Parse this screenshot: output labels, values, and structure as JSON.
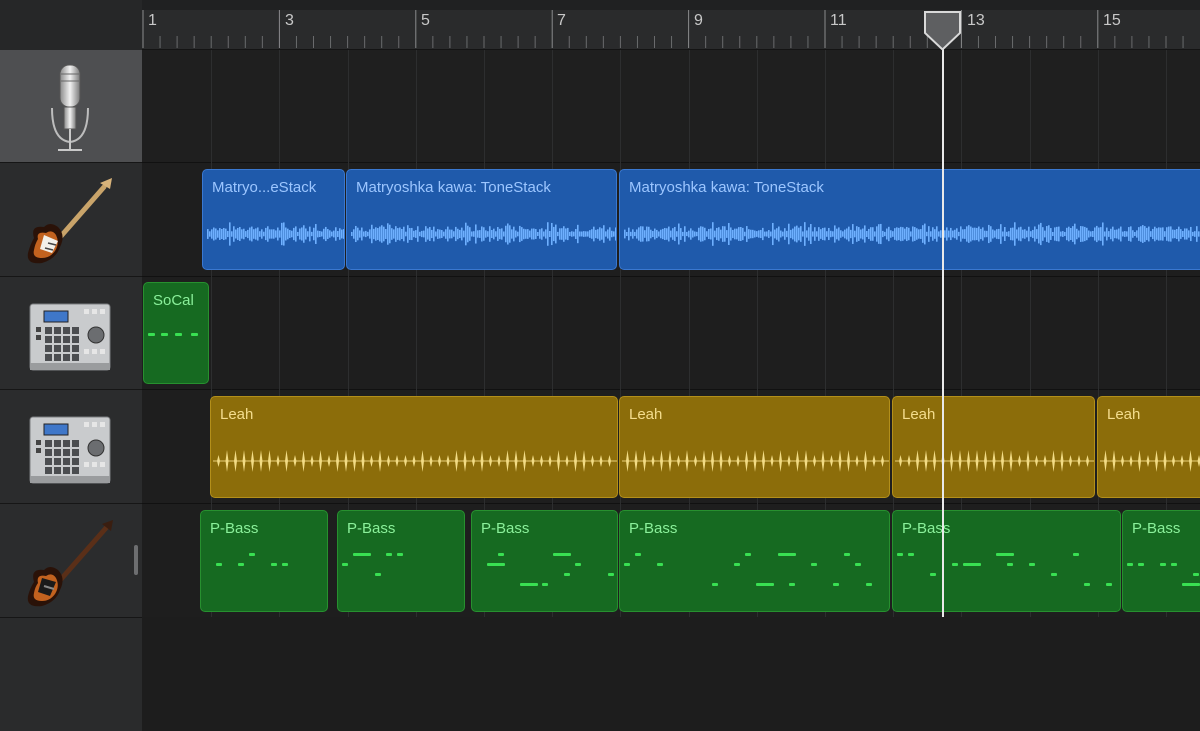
{
  "ruler": {
    "bar_numbers": [
      "1",
      "3",
      "5",
      "7",
      "9",
      "11",
      "13",
      "15"
    ]
  },
  "tracks": [
    {
      "name": "microphone-track",
      "icon": "microphone-icon",
      "selected": true
    },
    {
      "name": "electric-guitar-track",
      "icon": "electric-guitar-icon"
    },
    {
      "name": "drum-machine-track-1",
      "icon": "drum-machine-icon"
    },
    {
      "name": "drum-machine-track-2",
      "icon": "drum-machine-icon"
    },
    {
      "name": "bass-guitar-track",
      "icon": "bass-guitar-icon"
    }
  ],
  "regions": {
    "guitar": [
      "Matryo...eStack",
      "Matryoshka kawa: ToneStack",
      "Matryoshka kawa: ToneStack"
    ],
    "drums1": [
      "SoCal"
    ],
    "drums2": [
      "Leah",
      "Leah",
      "Leah",
      "Leah"
    ],
    "bass": [
      "P-Bass",
      "P-Bass",
      "P-Bass",
      "P-Bass",
      "P-Bass",
      "P-Bass"
    ]
  },
  "playhead": {
    "bar": 12.5
  },
  "colors": {
    "audio_region": "#1f5aab",
    "drummer_region": "#8c6d0a",
    "midi_region": "#166a21",
    "midi_note": "#39e052",
    "playhead": "#e9e9e9"
  }
}
